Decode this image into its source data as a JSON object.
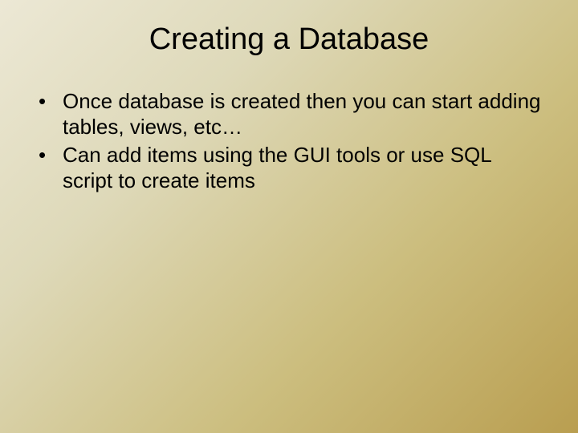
{
  "slide": {
    "title": "Creating a Database",
    "bullets": [
      "Once database is created then you can start adding tables, views, etc…",
      "Can add items using the GUI tools or use SQL script to create items"
    ]
  }
}
